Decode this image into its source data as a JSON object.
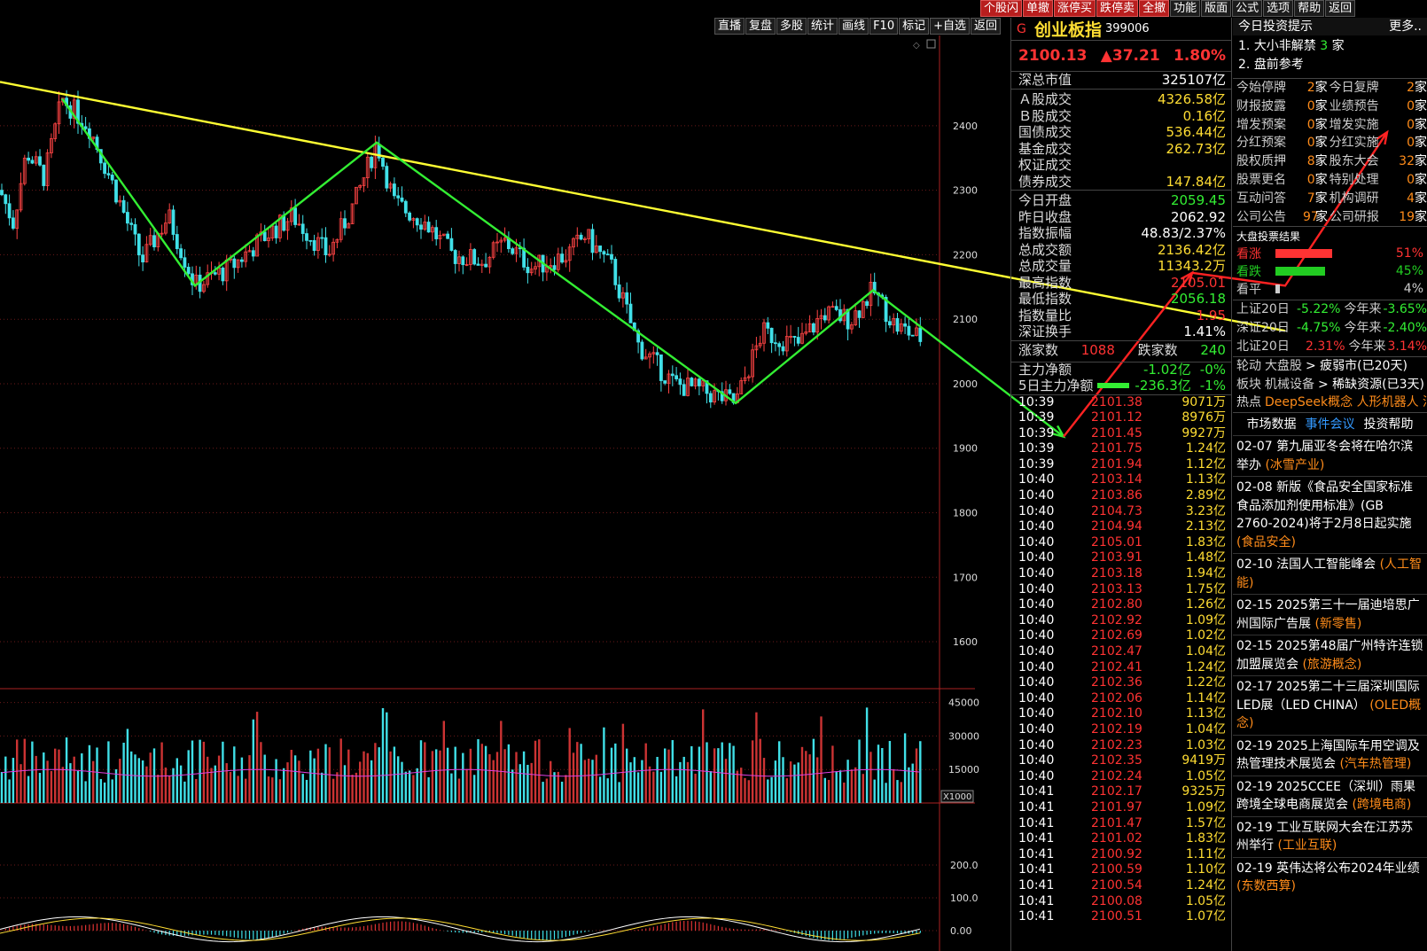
{
  "top_bar": [
    "个股闪",
    "单撤",
    "涨停买",
    "跌停卖",
    "全撤",
    "功能",
    "版面",
    "公式",
    "选项",
    "帮助",
    "返回"
  ],
  "chart_toolbar": [
    "直播",
    "复盘",
    "多股",
    "统计",
    "画线",
    "F10",
    "标记",
    "+自选",
    "返回"
  ],
  "price_axis": [
    "2400",
    "2300",
    "2200",
    "2100",
    "2000",
    "1900",
    "1800",
    "1700",
    "1600"
  ],
  "volume_axis": [
    "45000",
    "30000",
    "15000"
  ],
  "volume_unit": "X1000",
  "macd_axis": [
    "200.0",
    "100.0",
    "0.00"
  ],
  "quote": {
    "flag": "G",
    "name": "创业板指",
    "code": "399006",
    "price": "2100.13",
    "change": "▲37.21",
    "pct": "1.80%",
    "market_cap_label": "深总市值",
    "market_cap": "325107亿",
    "turnover": [
      {
        "label": "Ａ股成交",
        "value": "4326.58亿"
      },
      {
        "label": "Ｂ股成交",
        "value": "0.16亿"
      },
      {
        "label": "国债成交",
        "value": "536.44亿"
      },
      {
        "label": "基金成交",
        "value": "262.73亿"
      },
      {
        "label": "权证成交",
        "value": ""
      },
      {
        "label": "债券成交",
        "value": "147.84亿"
      }
    ],
    "stats": [
      {
        "label": "今日开盘",
        "value": "2059.45",
        "color": "g"
      },
      {
        "label": "昨日收盘",
        "value": "2062.92",
        "color": "w"
      },
      {
        "label": "指数振幅",
        "value": "48.83/2.37%",
        "color": "w"
      },
      {
        "label": "总成交额",
        "value": "2136.42亿",
        "color": "y"
      },
      {
        "label": "总成交量",
        "value": "11343.2万",
        "color": "y"
      },
      {
        "label": "最高指数",
        "value": "2105.01",
        "color": "rd"
      },
      {
        "label": "最低指数",
        "value": "2056.18",
        "color": "g"
      },
      {
        "label": "指数量比",
        "value": "1.95",
        "color": "rd"
      },
      {
        "label": "深证换手",
        "value": "1.41%",
        "color": "w"
      }
    ],
    "up_label": "涨家数",
    "up": "1088",
    "down_label": "跌家数",
    "down": "240",
    "main_flow_label": "主力净额",
    "main_flow": "-1.02亿",
    "main_flow_pct": "-0%",
    "flow5_label": "5日主力净额",
    "flow5": "-236.3亿",
    "flow5_pct": "-1%",
    "ticks": [
      [
        "10:39",
        "2101.38",
        "9071万"
      ],
      [
        "10:39",
        "2101.12",
        "8976万"
      ],
      [
        "10:39",
        "2101.45",
        "9927万"
      ],
      [
        "10:39",
        "2101.75",
        "1.24亿"
      ],
      [
        "10:39",
        "2101.94",
        "1.12亿"
      ],
      [
        "10:40",
        "2103.14",
        "1.13亿"
      ],
      [
        "10:40",
        "2103.86",
        "2.89亿"
      ],
      [
        "10:40",
        "2104.73",
        "3.23亿"
      ],
      [
        "10:40",
        "2104.94",
        "2.13亿"
      ],
      [
        "10:40",
        "2105.01",
        "1.83亿"
      ],
      [
        "10:40",
        "2103.91",
        "1.48亿"
      ],
      [
        "10:40",
        "2103.18",
        "1.94亿"
      ],
      [
        "10:40",
        "2103.13",
        "1.75亿"
      ],
      [
        "10:40",
        "2102.80",
        "1.26亿"
      ],
      [
        "10:40",
        "2102.92",
        "1.09亿"
      ],
      [
        "10:40",
        "2102.69",
        "1.02亿"
      ],
      [
        "10:40",
        "2102.47",
        "1.04亿"
      ],
      [
        "10:40",
        "2102.41",
        "1.24亿"
      ],
      [
        "10:40",
        "2102.36",
        "1.22亿"
      ],
      [
        "10:40",
        "2102.06",
        "1.14亿"
      ],
      [
        "10:40",
        "2102.10",
        "1.13亿"
      ],
      [
        "10:40",
        "2102.19",
        "1.04亿"
      ],
      [
        "10:40",
        "2102.23",
        "1.03亿"
      ],
      [
        "10:40",
        "2102.35",
        "9419万"
      ],
      [
        "10:40",
        "2102.24",
        "1.05亿"
      ],
      [
        "10:41",
        "2102.17",
        "9325万"
      ],
      [
        "10:41",
        "2101.97",
        "1.09亿"
      ],
      [
        "10:41",
        "2101.47",
        "1.57亿"
      ],
      [
        "10:41",
        "2101.02",
        "1.83亿"
      ],
      [
        "10:41",
        "2100.92",
        "1.11亿"
      ],
      [
        "10:41",
        "2100.59",
        "1.10亿"
      ],
      [
        "10:41",
        "2100.54",
        "1.24亿"
      ],
      [
        "10:41",
        "2100.08",
        "1.05亿"
      ],
      [
        "10:41",
        "2100.51",
        "1.07亿"
      ]
    ]
  },
  "news": {
    "title": "今日投资提示",
    "more": "更多..",
    "tips": [
      {
        "n": "1.",
        "text": "大小非解禁",
        "num": "3",
        "unit": "家"
      },
      {
        "n": "2.",
        "text": "盘前参考",
        "num": "",
        "unit": ""
      }
    ],
    "events": [
      [
        "今始停牌",
        "2",
        "家",
        "今日复牌",
        "2",
        "家"
      ],
      [
        "财报披露",
        "0",
        "家",
        "业绩预告",
        "0",
        "家"
      ],
      [
        "增发预案",
        "0",
        "家",
        "增发实施",
        "0",
        "家"
      ],
      [
        "分红预案",
        "0",
        "家",
        "分红实施",
        "0",
        "家"
      ],
      [
        "股权质押",
        "8",
        "家",
        "股东大会",
        "32",
        "家"
      ],
      [
        "股票更名",
        "0",
        "家",
        "特别处理",
        "0",
        "家"
      ],
      [
        "互动问答",
        "7",
        "家",
        "机构调研",
        "4",
        "家"
      ],
      [
        "公司公告",
        "97",
        "家",
        "公司研报",
        "19",
        "家"
      ]
    ],
    "vote_title": "大盘投票结果",
    "votes": [
      {
        "label": "看涨",
        "pct": "51%",
        "value": 51,
        "color": "#ff3333"
      },
      {
        "label": "看跌",
        "pct": "45%",
        "value": 45,
        "color": "#22cc22"
      },
      {
        "label": "看平",
        "pct": "4%",
        "value": 4,
        "color": "#cccccc"
      }
    ],
    "perf": [
      {
        "label": "上证20日",
        "v1": "-5.22%",
        "c1": "g",
        "l2": "今年来",
        "v2": "-3.65%",
        "c2": "g"
      },
      {
        "label": "深证20日",
        "v1": "-4.75%",
        "c1": "g",
        "l2": "今年来",
        "v2": "-2.40%",
        "c2": "g"
      },
      {
        "label": "北证20日",
        "v1": "2.31%",
        "c1": "rd",
        "l2": "今年来",
        "v2": "3.14%",
        "c2": "rd"
      }
    ],
    "rotation": [
      {
        "a": "轮动",
        "b": "大盘股",
        "c": "> 疲弱市(已20天)"
      },
      {
        "a": "板块",
        "b": "机械设备",
        "c": "> 稀缺资源(已3天)"
      }
    ],
    "hot_label": "热点",
    "hot": "DeepSeek概念 人形机器人 消",
    "tabs": [
      "市场数据",
      "事件会议",
      "投资帮助"
    ],
    "items": [
      [
        "02-07",
        "第九届亚冬会将在哈尔滨举办",
        "(冰雪产业)"
      ],
      [
        "02-08",
        "新版《食品安全国家标准 食品添加剂使用标准》(GB 2760-2024)将于2月8日起实施",
        "(食品安全)"
      ],
      [
        "02-10",
        "法国人工智能峰会",
        "(人工智能)"
      ],
      [
        "02-15",
        "2025第三十一届迪培思广州国际广告展",
        "(新零售)"
      ],
      [
        "02-15",
        "2025第48届广州特许连锁加盟展览会",
        "(旅游概念)"
      ],
      [
        "02-17",
        "2025第二十三届深圳国际LED展（LED CHINA）",
        "(OLED概念)"
      ],
      [
        "02-19",
        "2025上海国际车用空调及热管理技术展览会",
        "(汽车热管理)"
      ],
      [
        "02-19",
        "2025CCEE（深圳）雨果跨境全球电商展览会",
        "(跨境电商)"
      ],
      [
        "02-19",
        "工业互联网大会在江苏苏州举行",
        "(工业互联)"
      ],
      [
        "02-19",
        "英伟达将公布2024年业绩",
        "(东数西算)"
      ]
    ]
  },
  "chart_data": {
    "type": "candlestick",
    "y_range": [
      1530,
      2540
    ],
    "trendline": [
      [
        0,
        2468
      ],
      [
        1450,
        2082
      ]
    ],
    "zigzag_down_from_peak": [
      [
        70,
        2442
      ],
      [
        220,
        2152
      ],
      [
        425,
        2374
      ],
      [
        830,
        1970
      ],
      [
        985,
        2145
      ],
      [
        1200,
        1918
      ]
    ],
    "arrow_right": [
      [
        1200,
        1918
      ],
      [
        1345,
        2172
      ]
    ],
    "arrow_news": [
      [
        1345,
        2172
      ],
      [
        1450,
        2152
      ],
      [
        1565,
        2390
      ]
    ],
    "waypoints": [
      [
        0,
        2300
      ],
      [
        15,
        2250
      ],
      [
        30,
        2360
      ],
      [
        50,
        2320
      ],
      [
        70,
        2442
      ],
      [
        100,
        2400
      ],
      [
        130,
        2300
      ],
      [
        160,
        2190
      ],
      [
        190,
        2260
      ],
      [
        220,
        2152
      ],
      [
        260,
        2180
      ],
      [
        300,
        2230
      ],
      [
        330,
        2260
      ],
      [
        370,
        2200
      ],
      [
        400,
        2280
      ],
      [
        425,
        2374
      ],
      [
        445,
        2280
      ],
      [
        480,
        2250
      ],
      [
        510,
        2200
      ],
      [
        545,
        2190
      ],
      [
        570,
        2220
      ],
      [
        600,
        2180
      ],
      [
        640,
        2200
      ],
      [
        660,
        2230
      ],
      [
        690,
        2180
      ],
      [
        720,
        2060
      ],
      [
        760,
        2000
      ],
      [
        790,
        1990
      ],
      [
        830,
        1970
      ],
      [
        860,
        2080
      ],
      [
        900,
        2060
      ],
      [
        930,
        2110
      ],
      [
        960,
        2100
      ],
      [
        985,
        2145
      ],
      [
        1010,
        2090
      ],
      [
        1040,
        2070
      ]
    ]
  }
}
